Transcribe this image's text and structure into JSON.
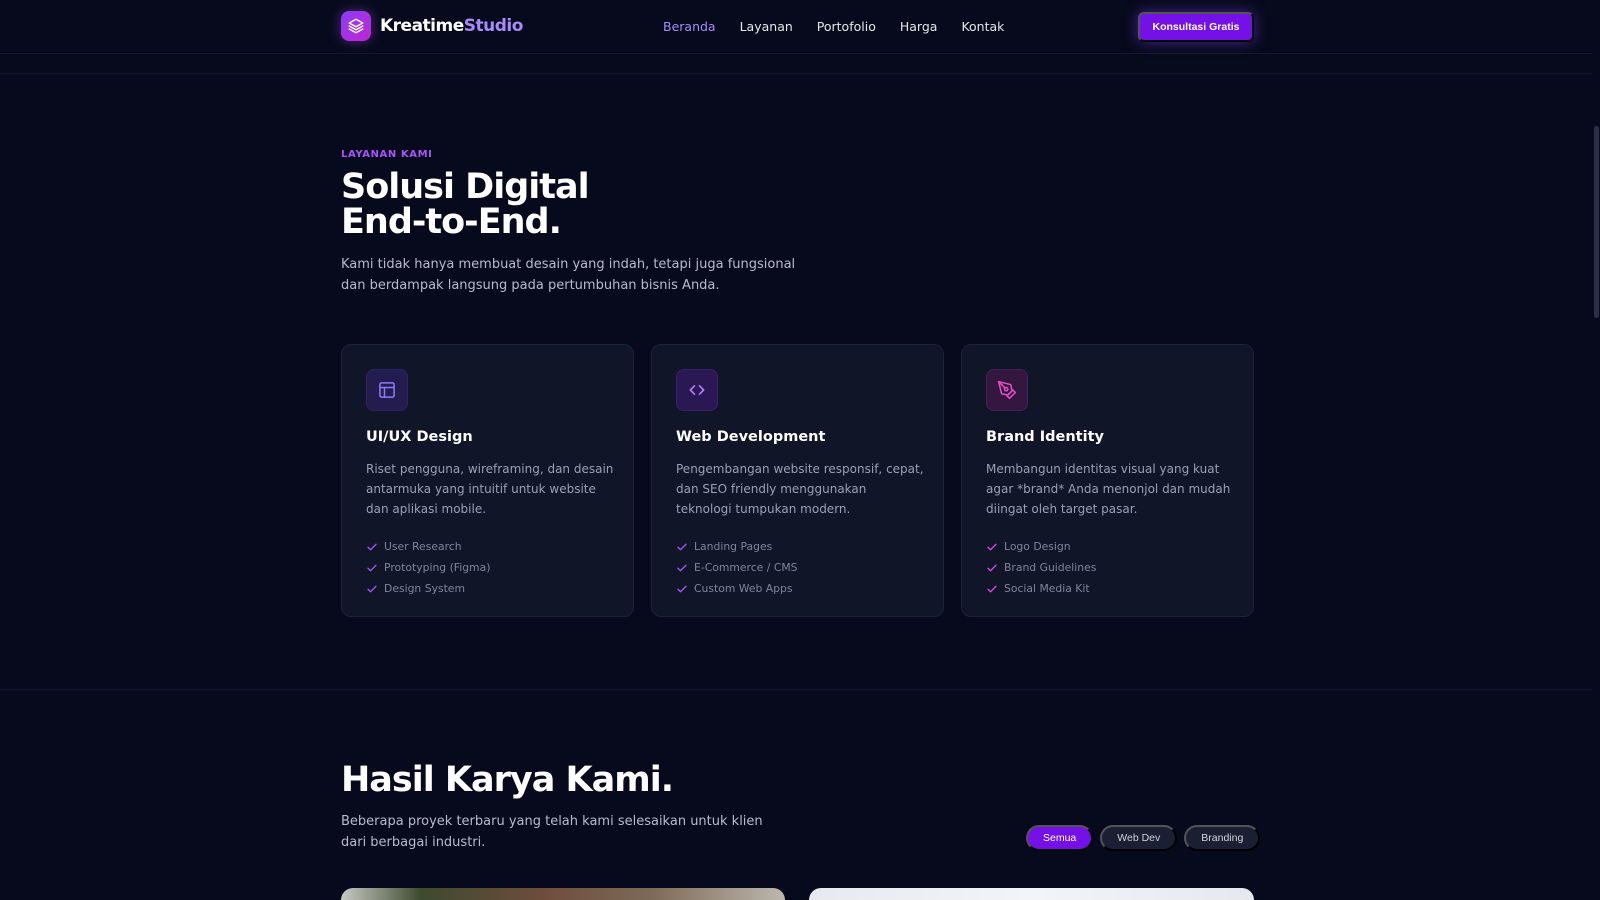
{
  "nav": {
    "brand_main": "Kreatime",
    "brand_accent": "Studio",
    "links": [
      "Beranda",
      "Layanan",
      "Portofolio",
      "Harga",
      "Kontak"
    ],
    "active_link": "Beranda",
    "cta_label": "Konsultasi Gratis"
  },
  "services": {
    "eyebrow": "LAYANAN KAMI",
    "title": "Solusi Digital\nEnd-to-End.",
    "description": "Kami tidak hanya membuat desain yang indah, tetapi juga fungsional dan berdampak langsung pada pertumbuhan bisnis Anda.",
    "cards": [
      {
        "icon": "layout-icon",
        "title": "UI/UX Design",
        "description": "Riset pengguna, wireframing, dan desain antarmuka yang intuitif untuk website dan aplikasi mobile.",
        "features": [
          "User Research",
          "Prototyping (Figma)",
          "Design System"
        ]
      },
      {
        "icon": "code-icon",
        "title": "Web Development",
        "description": "Pengembangan website responsif, cepat, dan SEO friendly menggunakan teknologi tumpukan modern.",
        "features": [
          "Landing Pages",
          "E-Commerce / CMS",
          "Custom Web Apps"
        ]
      },
      {
        "icon": "pen-tool-icon",
        "title": "Brand Identity",
        "description": "Membangun identitas visual yang kuat agar *brand* Anda menonjol dan mudah diingat oleh target pasar.",
        "features": [
          "Logo Design",
          "Brand Guidelines",
          "Social Media Kit"
        ]
      }
    ]
  },
  "portfolio": {
    "title": "Hasil Karya Kami.",
    "description": "Beberapa proyek terbaru yang telah kami selesaikan untuk klien dari berbagai industri.",
    "filters": [
      "Semua",
      "Web Dev",
      "Branding"
    ],
    "active_filter": "Semua"
  },
  "colors": {
    "background": "#070a1c",
    "accent": "#7411e7",
    "accent_light": "#a78bfa",
    "card": "#101528",
    "check": "#a855f7"
  }
}
